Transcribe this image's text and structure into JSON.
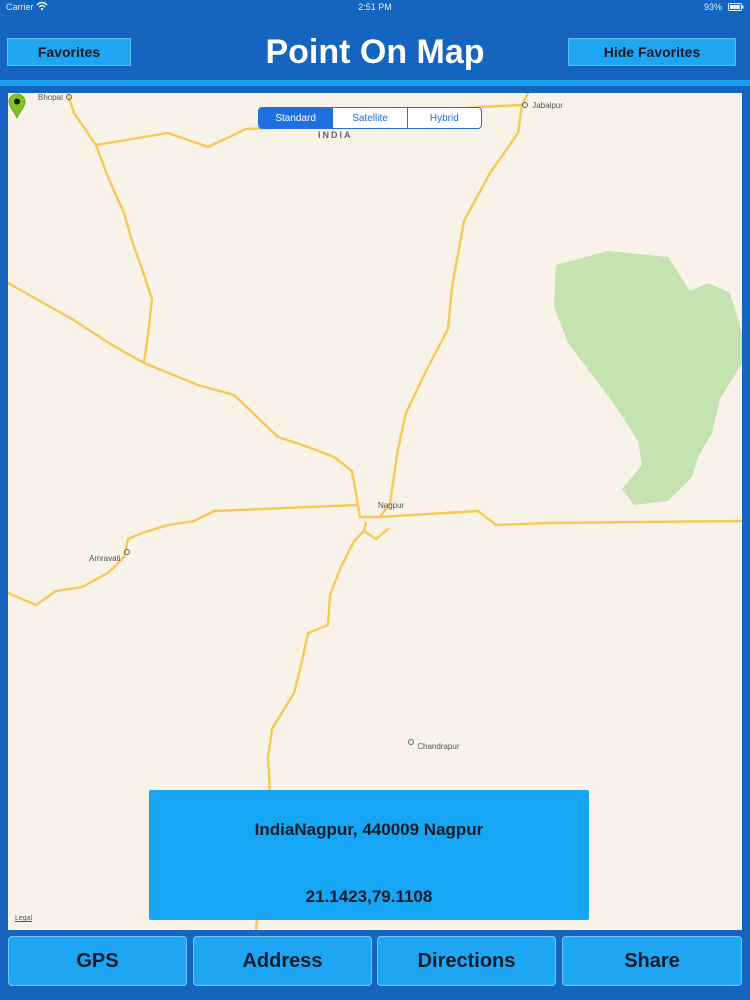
{
  "status_bar": {
    "carrier": "Carrier",
    "time": "2:51 PM",
    "battery": "93%"
  },
  "header": {
    "title": "Point On Map",
    "favorites_label": "Favorites",
    "hide_favorites_label": "Hide Favorites"
  },
  "map": {
    "segments": [
      "Standard",
      "Satellite",
      "Hybrid"
    ],
    "selected_segment": "Standard",
    "labels": {
      "country": "INDIA",
      "bhopal": "Bhopal",
      "jabalpur": "Jabalpur",
      "nagpur": "Nagpur",
      "amravati": "Amravati",
      "chandrapur": "Chandrapur"
    },
    "legal": "Legal",
    "colors": {
      "land": "#f8f2e9",
      "road": "#f6c955",
      "park": "#c4e3b0",
      "pin": "#7ec520"
    }
  },
  "info": {
    "address": "IndiaNagpur, 440009 Nagpur",
    "coordinates": "21.1423,79.1108"
  },
  "toolbar": {
    "gps": "GPS",
    "address": "Address",
    "directions": "Directions",
    "share": "Share"
  },
  "icons": [
    "wifi-icon",
    "battery-icon",
    "map-pin-icon",
    "city-dot-icon"
  ]
}
